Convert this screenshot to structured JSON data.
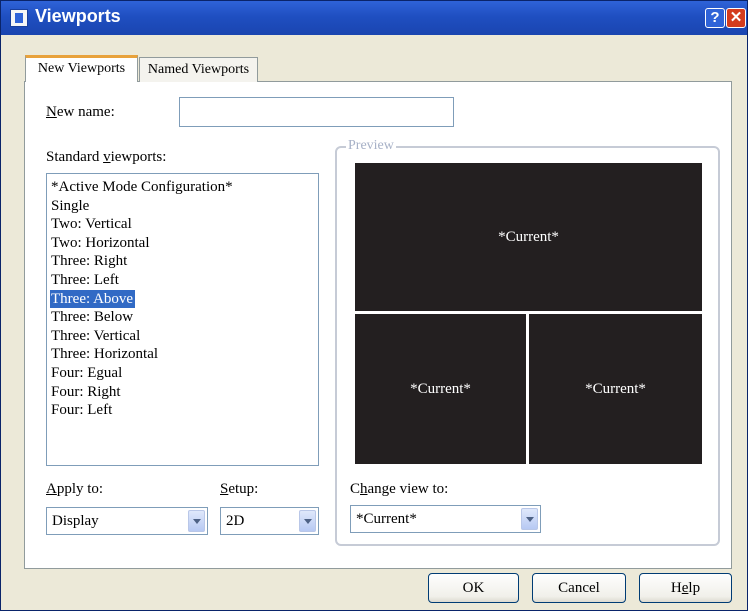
{
  "window": {
    "title": "Viewports",
    "help_glyph": "?",
    "close_glyph": "✕"
  },
  "tabs": [
    {
      "label": "New Viewports",
      "active": true
    },
    {
      "label": "Named Viewports",
      "active": false
    }
  ],
  "new_name": {
    "label_key": "N",
    "label_rest": "ew name:",
    "value": ""
  },
  "standard_viewports": {
    "label_pre": "Standard ",
    "label_key": "v",
    "label_rest": "iewports:",
    "items": [
      "*Active Mode Configuration*",
      "Single",
      "Two: Vertical",
      "Two: Horizontal",
      "Three: Right",
      "Three: Left",
      "Three: Above",
      "Three: Below",
      "Three: Vertical",
      "Three: Horizontal",
      "Four: Egual",
      "Four: Right",
      "Four: Left"
    ],
    "selected": "Three: Above"
  },
  "preview": {
    "legend": "Preview",
    "panes": [
      "*Current*",
      "*Current*",
      "*Current*"
    ]
  },
  "apply_to": {
    "label_key": "A",
    "label_rest": "pply to:",
    "value": "Display"
  },
  "setup": {
    "label_key": "S",
    "label_rest": "etup:",
    "value": "2D"
  },
  "change_view": {
    "label_pre": "C",
    "label_key": "h",
    "label_rest": "ange view to:",
    "value": "*Current*"
  },
  "buttons": {
    "ok": "OK",
    "cancel": "Cancel",
    "help_pre": "H",
    "help_key": "e",
    "help_rest": "lp"
  },
  "colors": {
    "titlebar": "#2f63d8",
    "selection": "#316ac5",
    "preview_pane": "#231f20",
    "active_tab_accent": "#e8a23b"
  }
}
